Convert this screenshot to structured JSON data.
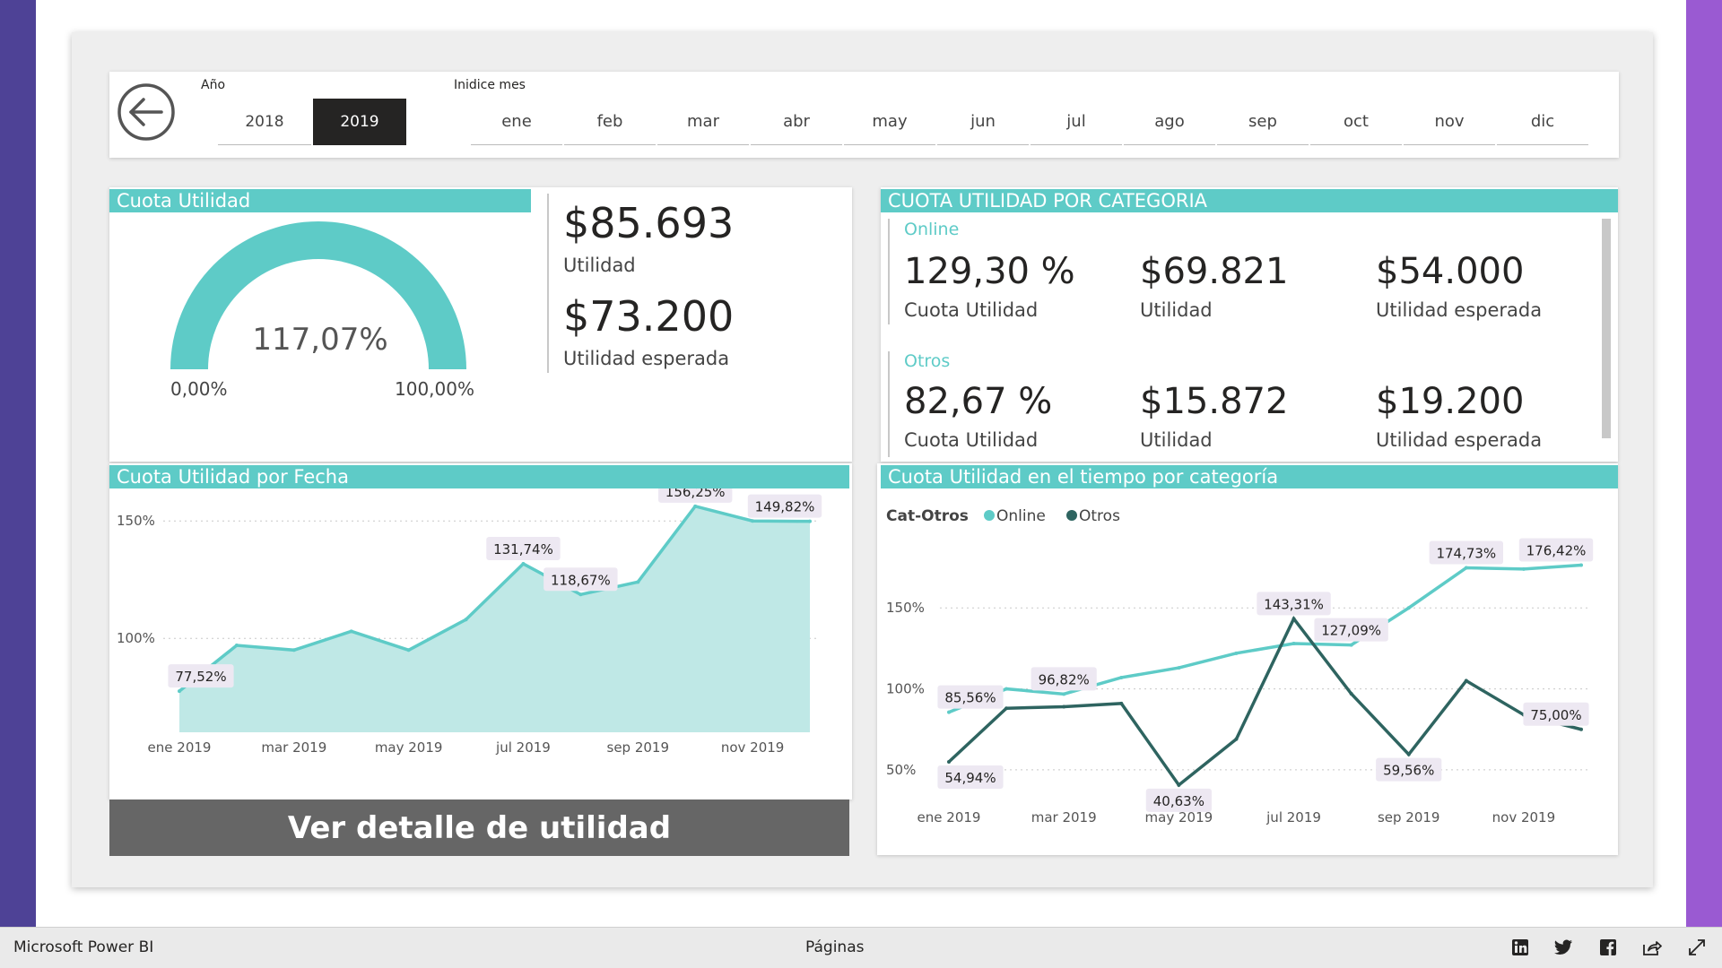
{
  "slicers": {
    "year_label": "Año",
    "years": [
      "2018",
      "2019"
    ],
    "selected_year": "2019",
    "month_label": "Inidice mes",
    "months": [
      "ene",
      "feb",
      "mar",
      "abr",
      "may",
      "jun",
      "jul",
      "ago",
      "sep",
      "oct",
      "nov",
      "dic"
    ]
  },
  "gauge": {
    "title": "Cuota Utilidad",
    "value_label": "117,07%",
    "value": 117.07,
    "min_label": "0,00%",
    "max_label": "100,00%",
    "max": 100,
    "color": "#5ecbc7"
  },
  "cards": {
    "utilidad_value": "$85.693",
    "utilidad_label": "Utilidad",
    "esperada_value": "$73.200",
    "esperada_label": "Utilidad esperada"
  },
  "category": {
    "title": "CUOTA UTILIDAD POR CATEGORIA",
    "groups": [
      {
        "name": "Online",
        "cuota": "129,30 %",
        "cuota_label": "Cuota Utilidad",
        "utilidad": "$69.821",
        "utilidad_label": "Utilidad",
        "esperada": "$54.000",
        "esperada_label": "Utilidad esperada"
      },
      {
        "name": "Otros",
        "cuota": "82,67 %",
        "cuota_label": "Cuota Utilidad",
        "utilidad": "$15.872",
        "utilidad_label": "Utilidad",
        "esperada": "$19.200",
        "esperada_label": "Utilidad esperada"
      }
    ]
  },
  "chart_data": [
    {
      "type": "area",
      "title": "Cuota Utilidad por Fecha",
      "x": [
        "ene 2019",
        "feb 2019",
        "mar 2019",
        "abr 2019",
        "may 2019",
        "jun 2019",
        "jul 2019",
        "ago 2019",
        "sep 2019",
        "oct 2019",
        "nov 2019",
        "dic 2019"
      ],
      "x_tick_labels": [
        "ene 2019",
        "mar 2019",
        "may 2019",
        "jul 2019",
        "sep 2019",
        "nov 2019"
      ],
      "series": [
        {
          "values": [
            77.52,
            97,
            95,
            103,
            95,
            108,
            131.74,
            118.67,
            124,
            156.25,
            150,
            149.82
          ],
          "color": "#5ecbc7"
        }
      ],
      "data_labels": [
        {
          "index": 0,
          "text": "77,52%"
        },
        {
          "index": 6,
          "text": "131,74%"
        },
        {
          "index": 7,
          "text": "118,67%"
        },
        {
          "index": 9,
          "text": "156,25%"
        },
        {
          "index": 11,
          "text": "149,82%"
        }
      ],
      "y_ticks": [
        {
          "value": 100,
          "label": "100%"
        },
        {
          "value": 150,
          "label": "150%"
        }
      ],
      "ylim": [
        60,
        160
      ]
    },
    {
      "type": "line",
      "title": "Cuota Utilidad en el tiempo por categoría",
      "legend_title": "Cat-Otros",
      "x": [
        "ene 2019",
        "feb 2019",
        "mar 2019",
        "abr 2019",
        "may 2019",
        "jun 2019",
        "jul 2019",
        "ago 2019",
        "sep 2019",
        "oct 2019",
        "nov 2019",
        "dic 2019"
      ],
      "x_tick_labels": [
        "ene 2019",
        "mar 2019",
        "may 2019",
        "jul 2019",
        "sep 2019",
        "nov 2019"
      ],
      "series": [
        {
          "name": "Online",
          "color": "#5ecbc7",
          "values": [
            85.56,
            100,
            96.82,
            107,
            113,
            122,
            128,
            127.09,
            150,
            174.73,
            174,
            176.42
          ]
        },
        {
          "name": "Otros",
          "color": "#2e6460",
          "values": [
            54.94,
            88,
            89,
            91,
            40.63,
            69,
            143.31,
            97,
            59.56,
            105,
            84,
            75
          ]
        }
      ],
      "data_labels": [
        {
          "series": 0,
          "index": 0,
          "text": "85,56%"
        },
        {
          "series": 0,
          "index": 2,
          "text": "96,82%"
        },
        {
          "series": 0,
          "index": 7,
          "text": "127,09%"
        },
        {
          "series": 0,
          "index": 9,
          "text": "174,73%"
        },
        {
          "series": 0,
          "index": 11,
          "text": "176,42%"
        },
        {
          "series": 1,
          "index": 0,
          "text": "54,94%"
        },
        {
          "series": 1,
          "index": 4,
          "text": "40,63%"
        },
        {
          "series": 1,
          "index": 6,
          "text": "143,31%"
        },
        {
          "series": 1,
          "index": 8,
          "text": "59,56%"
        },
        {
          "series": 1,
          "index": 11,
          "text": "75,00%"
        }
      ],
      "y_ticks": [
        {
          "value": 50,
          "label": "50%"
        },
        {
          "value": 100,
          "label": "100%"
        },
        {
          "value": 150,
          "label": "150%"
        }
      ],
      "ylim": [
        40,
        185
      ]
    }
  ],
  "detail_button": "Ver detalle de utilidad",
  "footer": {
    "brand": "Microsoft Power BI",
    "pages": "Páginas",
    "icons": [
      "linkedin-icon",
      "twitter-icon",
      "facebook-icon",
      "share-icon",
      "fullscreen-icon"
    ]
  }
}
